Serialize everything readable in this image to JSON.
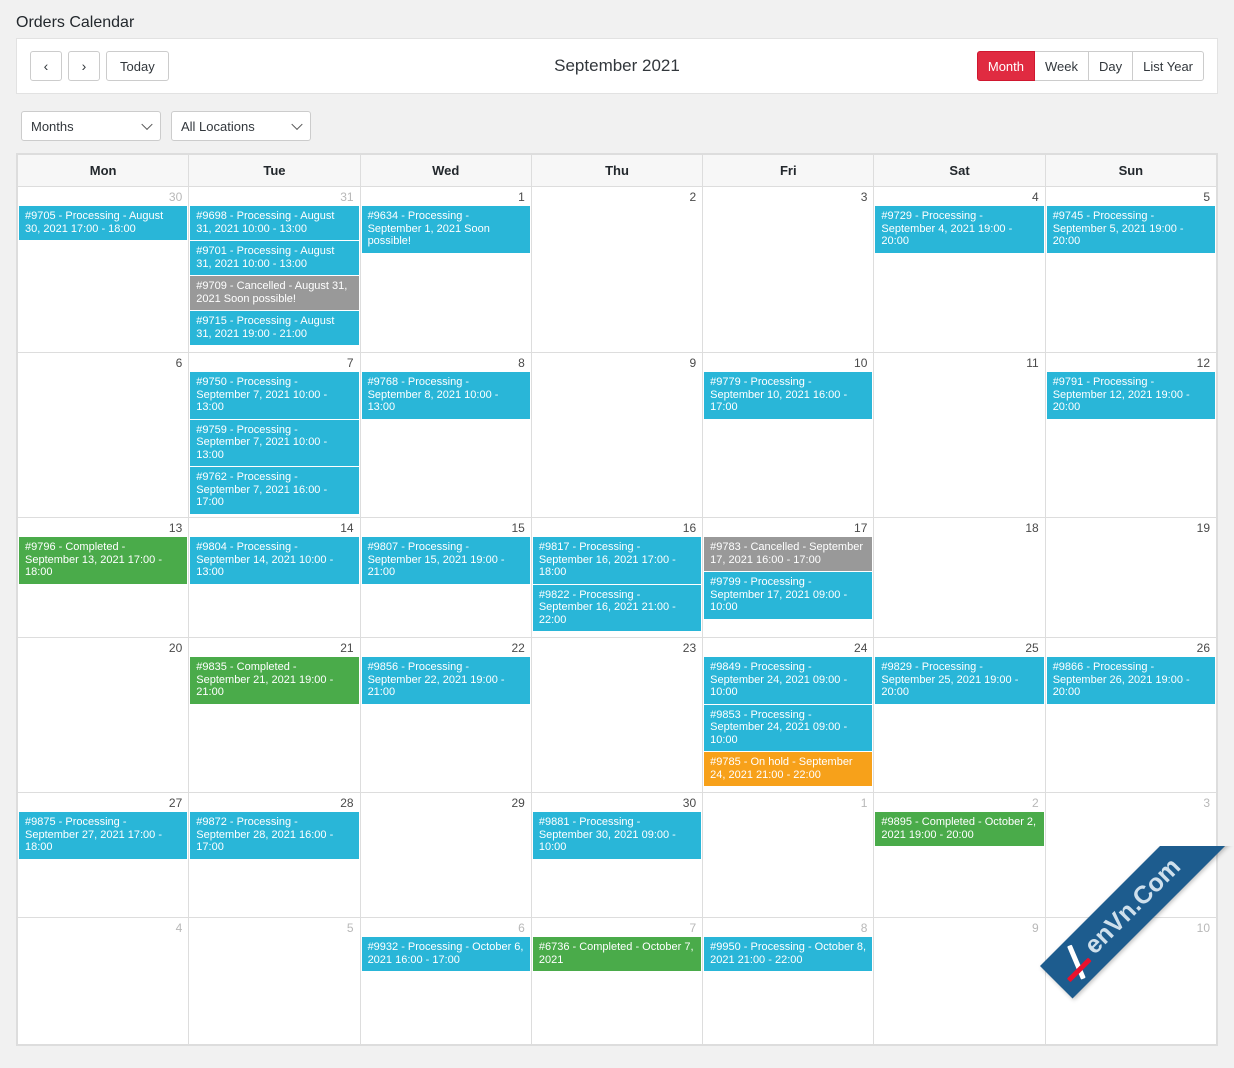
{
  "page_title": "Orders Calendar",
  "toolbar": {
    "prev_label": "‹",
    "next_label": "›",
    "today_label": "Today",
    "title": "September 2021",
    "views": [
      {
        "label": "Month",
        "active": true
      },
      {
        "label": "Week",
        "active": false
      },
      {
        "label": "Day",
        "active": false
      },
      {
        "label": "List Year",
        "active": false
      }
    ],
    "active_color": "#e02b41"
  },
  "filters": [
    {
      "name": "period-select",
      "value": "Months"
    },
    {
      "name": "location-select",
      "value": "All Locations"
    }
  ],
  "calendar": {
    "weekday_headers": [
      "Mon",
      "Tue",
      "Wed",
      "Thu",
      "Fri",
      "Sat",
      "Sun"
    ],
    "status_colors": {
      "processing": "#29b6d8",
      "completed": "#4aab4a",
      "cancelled": "#999999",
      "onhold": "#f7a11a"
    },
    "weeks": [
      {
        "days": [
          {
            "num": "30",
            "other_month": true,
            "events": [
              {
                "text": "#9705 - Processing - August 30, 2021 17:00 - 18:00",
                "status": "processing"
              }
            ]
          },
          {
            "num": "31",
            "other_month": true,
            "events": [
              {
                "text": "#9698 - Processing - August 31, 2021 10:00 - 13:00",
                "status": "processing"
              },
              {
                "text": "#9701 - Processing - August 31, 2021 10:00 - 13:00",
                "status": "processing"
              },
              {
                "text": "#9709 - Cancelled - August 31, 2021 Soon possible!",
                "status": "cancelled"
              },
              {
                "text": "#9715 - Processing - August 31, 2021 19:00 - 21:00",
                "status": "processing"
              }
            ]
          },
          {
            "num": "1",
            "other_month": false,
            "events": [
              {
                "text": "#9634 - Processing - September 1, 2021 Soon possible!",
                "status": "processing"
              }
            ]
          },
          {
            "num": "2",
            "other_month": false,
            "events": []
          },
          {
            "num": "3",
            "other_month": false,
            "events": []
          },
          {
            "num": "4",
            "other_month": false,
            "events": [
              {
                "text": "#9729 - Processing - September 4, 2021 19:00 - 20:00",
                "status": "processing"
              }
            ]
          },
          {
            "num": "5",
            "other_month": false,
            "events": [
              {
                "text": "#9745 - Processing - September 5, 2021 19:00 - 20:00",
                "status": "processing"
              }
            ]
          }
        ]
      },
      {
        "days": [
          {
            "num": "6",
            "other_month": false,
            "events": []
          },
          {
            "num": "7",
            "other_month": false,
            "events": [
              {
                "text": "#9750 - Processing - September 7, 2021 10:00 - 13:00",
                "status": "processing"
              },
              {
                "text": "#9759 - Processing - September 7, 2021 10:00 - 13:00",
                "status": "processing"
              },
              {
                "text": "#9762 - Processing - September 7, 2021 16:00 - 17:00",
                "status": "processing"
              }
            ]
          },
          {
            "num": "8",
            "other_month": false,
            "events": [
              {
                "text": "#9768 - Processing - September 8, 2021 10:00 - 13:00",
                "status": "processing"
              }
            ]
          },
          {
            "num": "9",
            "other_month": false,
            "events": []
          },
          {
            "num": "10",
            "other_month": false,
            "events": [
              {
                "text": "#9779 - Processing - September 10, 2021 16:00 - 17:00",
                "status": "processing"
              }
            ]
          },
          {
            "num": "11",
            "other_month": false,
            "events": []
          },
          {
            "num": "12",
            "other_month": false,
            "events": [
              {
                "text": "#9791 - Processing - September 12, 2021 19:00 - 20:00",
                "status": "processing"
              }
            ]
          }
        ]
      },
      {
        "days": [
          {
            "num": "13",
            "other_month": false,
            "events": [
              {
                "text": "#9796 - Completed - September 13, 2021 17:00 - 18:00",
                "status": "completed"
              }
            ]
          },
          {
            "num": "14",
            "other_month": false,
            "events": [
              {
                "text": "#9804 - Processing - September 14, 2021 10:00 - 13:00",
                "status": "processing"
              }
            ]
          },
          {
            "num": "15",
            "other_month": false,
            "events": [
              {
                "text": "#9807 - Processing - September 15, 2021 19:00 - 21:00",
                "status": "processing"
              }
            ]
          },
          {
            "num": "16",
            "other_month": false,
            "events": [
              {
                "text": "#9817 - Processing - September 16, 2021 17:00 - 18:00",
                "status": "processing"
              },
              {
                "text": "#9822 - Processing - September 16, 2021 21:00 - 22:00",
                "status": "processing"
              }
            ]
          },
          {
            "num": "17",
            "other_month": false,
            "events": [
              {
                "text": "#9783 - Cancelled - September 17, 2021 16:00 - 17:00",
                "status": "cancelled"
              },
              {
                "text": "#9799 - Processing - September 17, 2021 09:00 - 10:00",
                "status": "processing"
              }
            ]
          },
          {
            "num": "18",
            "other_month": false,
            "events": []
          },
          {
            "num": "19",
            "other_month": false,
            "events": []
          }
        ]
      },
      {
        "days": [
          {
            "num": "20",
            "other_month": false,
            "events": []
          },
          {
            "num": "21",
            "other_month": false,
            "events": [
              {
                "text": "#9835 - Completed - September 21, 2021 19:00 - 21:00",
                "status": "completed"
              }
            ]
          },
          {
            "num": "22",
            "other_month": false,
            "events": [
              {
                "text": "#9856 - Processing - September 22, 2021 19:00 - 21:00",
                "status": "processing"
              }
            ]
          },
          {
            "num": "23",
            "other_month": false,
            "events": []
          },
          {
            "num": "24",
            "other_month": false,
            "events": [
              {
                "text": "#9849 - Processing - September 24, 2021 09:00 - 10:00",
                "status": "processing"
              },
              {
                "text": "#9853 - Processing - September 24, 2021 09:00 - 10:00",
                "status": "processing"
              },
              {
                "text": "#9785 - On hold - September 24, 2021 21:00 - 22:00",
                "status": "onhold"
              }
            ]
          },
          {
            "num": "25",
            "other_month": false,
            "events": [
              {
                "text": "#9829 - Processing - September 25, 2021 19:00 - 20:00",
                "status": "processing"
              }
            ]
          },
          {
            "num": "26",
            "other_month": false,
            "events": [
              {
                "text": "#9866 - Processing - September 26, 2021 19:00 - 20:00",
                "status": "processing"
              }
            ]
          }
        ]
      },
      {
        "days": [
          {
            "num": "27",
            "other_month": false,
            "events": [
              {
                "text": "#9875 - Processing - September 27, 2021 17:00 - 18:00",
                "status": "processing"
              }
            ]
          },
          {
            "num": "28",
            "other_month": false,
            "events": [
              {
                "text": "#9872 - Processing - September 28, 2021 16:00 - 17:00",
                "status": "processing"
              }
            ]
          },
          {
            "num": "29",
            "other_month": false,
            "events": []
          },
          {
            "num": "30",
            "other_month": false,
            "events": [
              {
                "text": "#9881 - Processing - September 30, 2021 09:00 - 10:00",
                "status": "processing"
              }
            ]
          },
          {
            "num": "1",
            "other_month": true,
            "events": []
          },
          {
            "num": "2",
            "other_month": true,
            "events": [
              {
                "text": "#9895 - Completed - October 2, 2021 19:00 - 20:00",
                "status": "completed"
              }
            ]
          },
          {
            "num": "3",
            "other_month": true,
            "events": []
          }
        ]
      },
      {
        "days": [
          {
            "num": "4",
            "other_month": true,
            "events": []
          },
          {
            "num": "5",
            "other_month": true,
            "events": []
          },
          {
            "num": "6",
            "other_month": true,
            "events": [
              {
                "text": "#9932 - Processing - October 6, 2021 16:00 - 17:00",
                "status": "processing"
              }
            ]
          },
          {
            "num": "7",
            "other_month": true,
            "events": [
              {
                "text": "#6736 - Completed - October 7, 2021",
                "status": "completed"
              }
            ]
          },
          {
            "num": "8",
            "other_month": true,
            "events": [
              {
                "text": "#9950 - Processing - October 8, 2021 21:00 - 22:00",
                "status": "processing"
              }
            ]
          },
          {
            "num": "9",
            "other_month": true,
            "events": []
          },
          {
            "num": "10",
            "other_month": true,
            "events": []
          }
        ]
      }
    ]
  },
  "watermark": {
    "text": "enVn.Com"
  }
}
